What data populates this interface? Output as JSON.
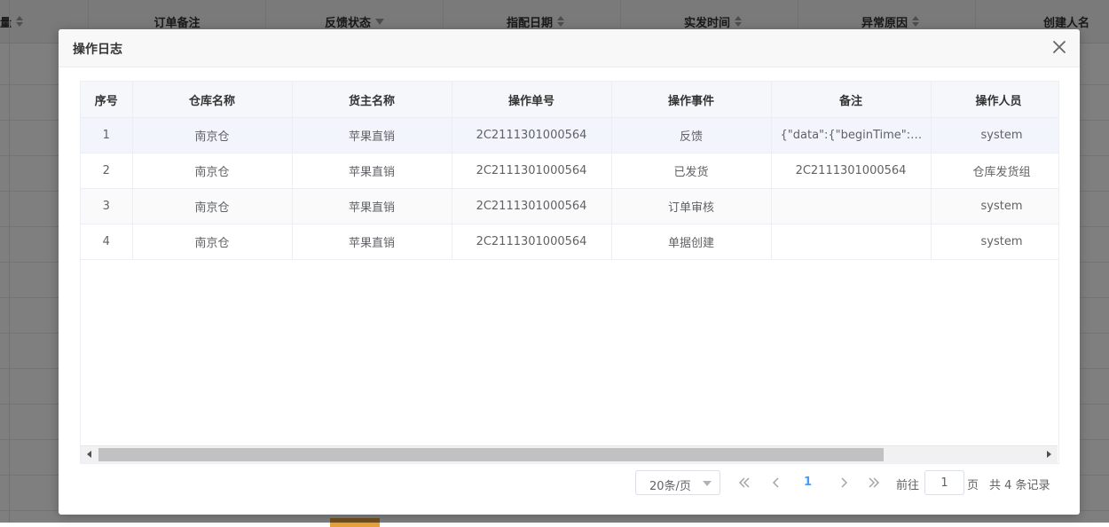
{
  "background": {
    "columns": [
      {
        "label": "量",
        "sort": true
      },
      {
        "label": "订单备注",
        "sort": false
      },
      {
        "label": "反馈状态",
        "filter": true
      },
      {
        "label": "指配日期",
        "sort": true
      },
      {
        "label": "实发时间",
        "sort": true
      },
      {
        "label": "异常原因",
        "sort": true
      },
      {
        "label": "创建人名",
        "sort": false
      }
    ],
    "right_cell": "n"
  },
  "dialog": {
    "title": "操作日志",
    "close_icon": "close-icon",
    "table": {
      "columns": [
        "序号",
        "仓库名称",
        "货主名称",
        "操作单号",
        "操作事件",
        "备注",
        "操作人员"
      ],
      "rows": [
        [
          "1",
          "南京仓",
          "苹果直销",
          "2C2111301000564",
          "反馈",
          "{\"data\":{\"beginTime\":\"202...",
          "system"
        ],
        [
          "2",
          "南京仓",
          "苹果直销",
          "2C2111301000564",
          "已发货",
          "2C2111301000564",
          "仓库发货组"
        ],
        [
          "3",
          "南京仓",
          "苹果直销",
          "2C2111301000564",
          "订单审核",
          "",
          "system"
        ],
        [
          "4",
          "南京仓",
          "苹果直销",
          "2C2111301000564",
          "单据创建",
          "",
          "system"
        ]
      ]
    },
    "pagination": {
      "page_size": "20条/页",
      "current_page": "1",
      "goto_label": "前往",
      "goto_value": "1",
      "page_unit": "页",
      "total": "共 4 条记录"
    }
  },
  "colors": {
    "accent": "#409eff",
    "overlay": "#000000",
    "warning_button": "#e6a23c"
  }
}
